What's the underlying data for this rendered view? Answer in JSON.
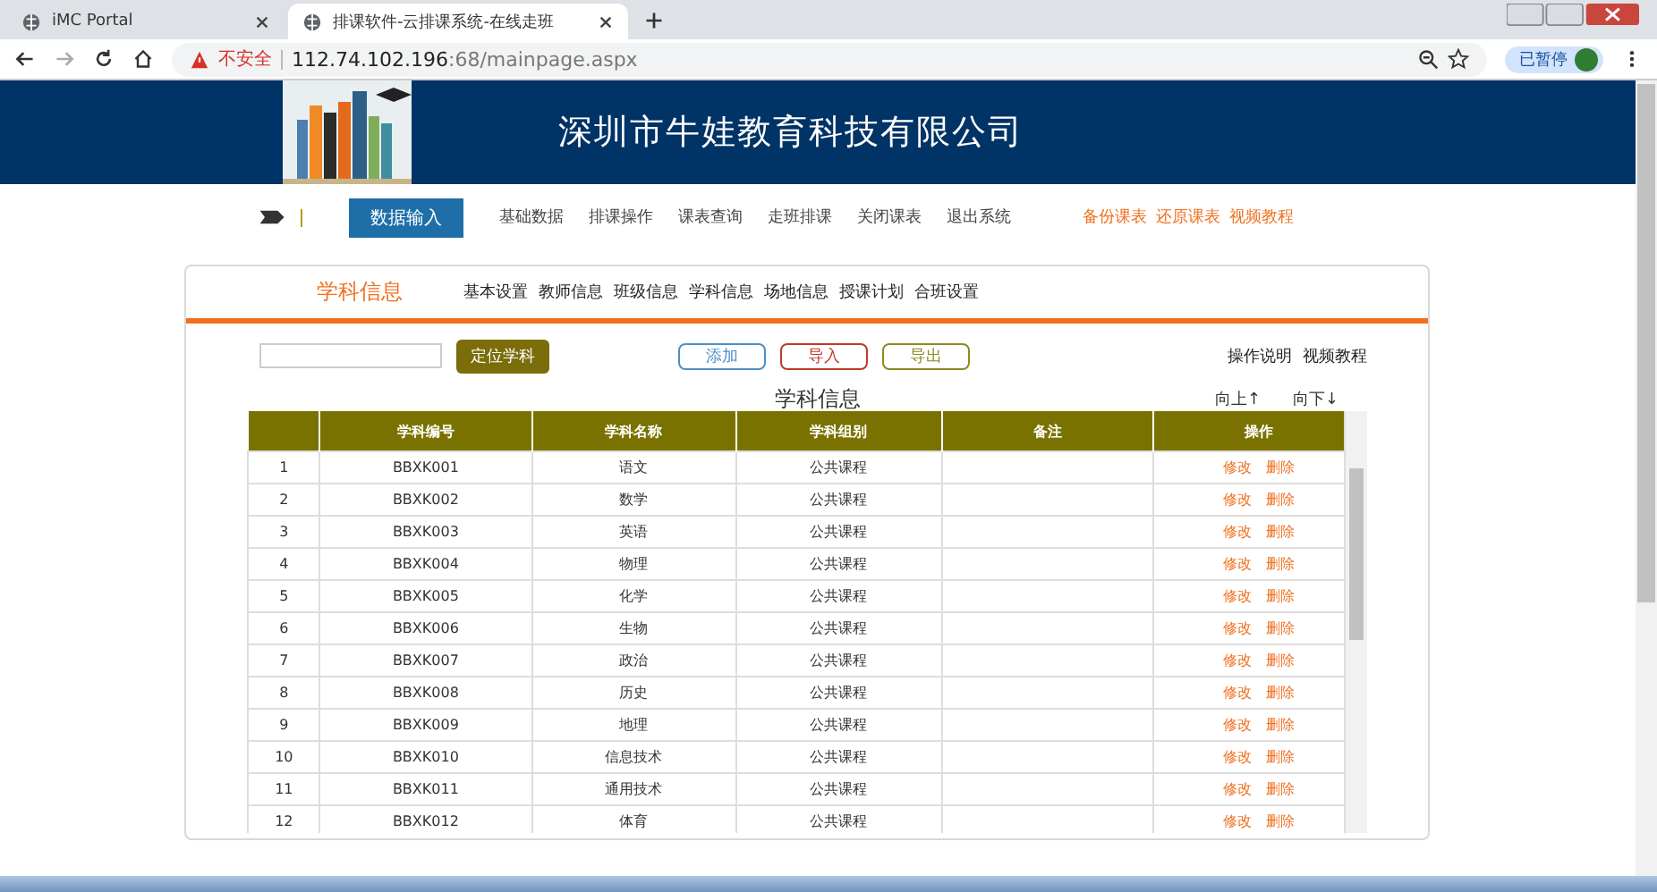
{
  "browser": {
    "tabs": [
      {
        "title": "iMC Portal",
        "selected": false
      },
      {
        "title": "排课软件-云排课系统-在线走班",
        "selected": true
      }
    ],
    "security": "不安全",
    "url_host": "112.74.102.196",
    "url_path": ":68/mainpage.aspx",
    "profile": "已暂停"
  },
  "header": {
    "title": "深圳市牛娃教育科技有限公司"
  },
  "nav": [
    {
      "label": "数据输入",
      "kind": "tab",
      "selected": true
    },
    {
      "label": "基础数据",
      "kind": "tab",
      "selected": false
    },
    {
      "label": "排课操作",
      "kind": "tab",
      "selected": false
    },
    {
      "label": "课表查询",
      "kind": "tab",
      "selected": false
    },
    {
      "label": "走班排课",
      "kind": "tab",
      "selected": false
    },
    {
      "label": "关闭课表",
      "kind": "tab",
      "selected": false
    },
    {
      "label": "退出系统",
      "kind": "tab",
      "selected": false
    },
    {
      "label": "备份课表",
      "kind": "link",
      "selected": false
    },
    {
      "label": "还原课表",
      "kind": "link",
      "selected": false
    },
    {
      "label": "视频教程",
      "kind": "link",
      "selected": false
    }
  ],
  "section": {
    "title": "学科信息",
    "items": [
      "基本设置",
      "教师信息",
      "班级信息",
      "学科信息",
      "场地信息",
      "授课计划",
      "合班设置"
    ]
  },
  "toolbar": {
    "locate_button": "定位学科",
    "buttons": [
      {
        "label": "添加",
        "color": "#4a90c8"
      },
      {
        "label": "导入",
        "color": "#c0392b"
      },
      {
        "label": "导出",
        "color": "#8a8a20"
      }
    ],
    "links": [
      "操作说明",
      "视频教程"
    ]
  },
  "table": {
    "title": "学科信息",
    "move_up": "向上↑",
    "move_down": "向下↓",
    "columns": [
      "学科编号",
      "学科名称",
      "学科组别",
      "备注",
      "操作"
    ],
    "rows": [
      {
        "no": "1",
        "code": "BBXK001",
        "name": "语文",
        "group": "公共课程",
        "edit": "修改",
        "delete": "删除"
      },
      {
        "no": "2",
        "code": "BBXK002",
        "name": "数学",
        "group": "公共课程",
        "edit": "修改",
        "delete": "删除"
      },
      {
        "no": "3",
        "code": "BBXK003",
        "name": "英语",
        "group": "公共课程",
        "edit": "修改",
        "delete": "删除"
      },
      {
        "no": "4",
        "code": "BBXK004",
        "name": "物理",
        "group": "公共课程",
        "edit": "修改",
        "delete": "删除"
      },
      {
        "no": "5",
        "code": "BBXK005",
        "name": "化学",
        "group": "公共课程",
        "edit": "修改",
        "delete": "删除"
      },
      {
        "no": "6",
        "code": "BBXK006",
        "name": "生物",
        "group": "公共课程",
        "edit": "修改",
        "delete": "删除"
      },
      {
        "no": "7",
        "code": "BBXK007",
        "name": "政治",
        "group": "公共课程",
        "edit": "修改",
        "delete": "删除"
      },
      {
        "no": "8",
        "code": "BBXK008",
        "name": "历史",
        "group": "公共课程",
        "edit": "修改",
        "delete": "删除"
      },
      {
        "no": "9",
        "code": "BBXK009",
        "name": "地理",
        "group": "公共课程",
        "edit": "修改",
        "delete": "删除"
      },
      {
        "no": "10",
        "code": "BBXK010",
        "name": "信息技术",
        "group": "公共课程",
        "edit": "修改",
        "delete": "删除"
      },
      {
        "no": "11",
        "code": "BBXK011",
        "name": "通用技术",
        "group": "公共课程",
        "edit": "修改",
        "delete": "删除"
      },
      {
        "no": "12",
        "code": "BBXK012",
        "name": "体育",
        "group": "公共课程",
        "edit": "修改",
        "delete": "删除"
      }
    ]
  }
}
